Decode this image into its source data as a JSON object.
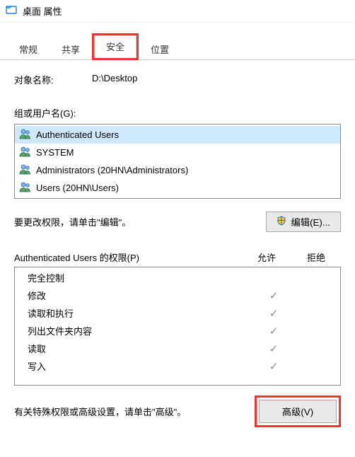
{
  "window": {
    "title": "桌面 属性"
  },
  "tabs": {
    "t0": "常规",
    "t1": "共享",
    "t2": "安全",
    "t3": "位置",
    "active_index": 2
  },
  "object": {
    "label": "对象名称:",
    "value": "D:\\Desktop"
  },
  "groups": {
    "label": "组或用户名(G):",
    "items": [
      {
        "name": "Authenticated Users",
        "selected": true
      },
      {
        "name": "SYSTEM",
        "selected": false
      },
      {
        "name": "Administrators (20HN\\Administrators)",
        "selected": false
      },
      {
        "name": "Users (20HN\\Users)",
        "selected": false
      }
    ]
  },
  "edit": {
    "hint": "要更改权限，请单击\"编辑\"。",
    "button": "编辑(E)..."
  },
  "perm": {
    "header_subject": "Authenticated Users 的权限(P)",
    "col_allow": "允许",
    "col_deny": "拒绝",
    "rows": [
      {
        "name": "完全控制",
        "allow": false,
        "deny": false
      },
      {
        "name": "修改",
        "allow": true,
        "deny": false
      },
      {
        "name": "读取和执行",
        "allow": true,
        "deny": false
      },
      {
        "name": "列出文件夹内容",
        "allow": true,
        "deny": false
      },
      {
        "name": "读取",
        "allow": true,
        "deny": false
      },
      {
        "name": "写入",
        "allow": true,
        "deny": false
      }
    ]
  },
  "advanced": {
    "hint": "有关特殊权限或高级设置，请单击\"高级\"。",
    "button": "高级(V)"
  }
}
